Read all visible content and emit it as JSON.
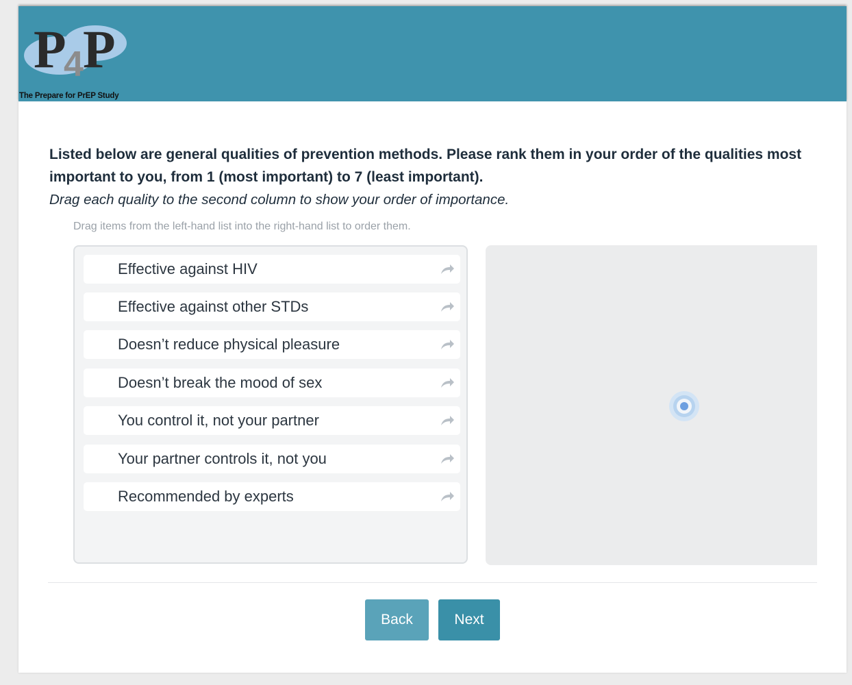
{
  "header": {
    "logo_text": "P4P",
    "tagline": "The Prepare for PrEP Study",
    "bg_color": "#3f93ad"
  },
  "question": {
    "main": "Listed below are general qualities of prevention methods. Please rank them in your order of the qualities most important to you, from 1 (most important) to 7 (least important).",
    "instruction": "Drag each quality to the second column to show your order of importance.",
    "hint": "Drag items from the left-hand list into the right-hand list to order them."
  },
  "items": [
    {
      "label": "Effective against HIV",
      "icon": "move-right-arrow-icon"
    },
    {
      "label": "Effective against other STDs",
      "icon": "move-right-arrow-icon"
    },
    {
      "label": "Doesn’t reduce physical pleasure",
      "icon": "move-right-arrow-icon"
    },
    {
      "label": "Doesn’t break the mood of sex",
      "icon": "move-right-arrow-icon"
    },
    {
      "label": "You control it, not your partner",
      "icon": "move-right-arrow-icon"
    },
    {
      "label": "Your partner controls it, not you",
      "icon": "move-right-arrow-icon"
    },
    {
      "label": "Recommended by experts",
      "icon": "move-right-arrow-icon"
    }
  ],
  "ranked_list": {
    "items": [],
    "indicator": "loading-spinner-icon"
  },
  "buttons": {
    "back_label": "Back",
    "next_label": "Next",
    "back_color": "#5aa3b9",
    "next_color": "#3a90a8"
  }
}
